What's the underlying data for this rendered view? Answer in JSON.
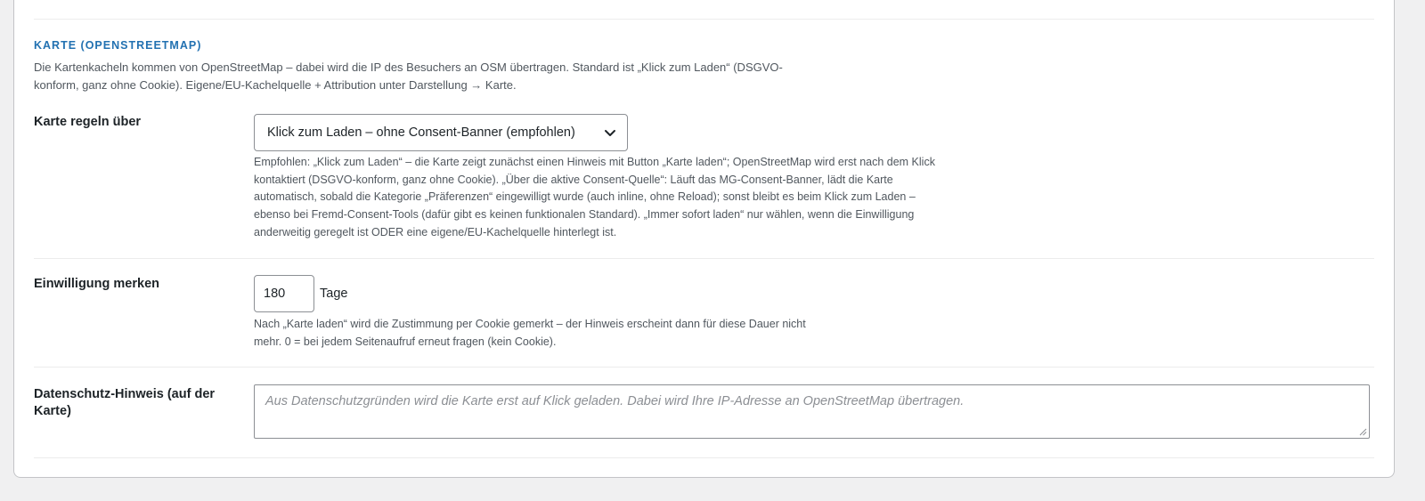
{
  "section": {
    "title": "KARTE (OPENSTREETMAP)",
    "description_line1": "Die Kartenkacheln kommen von OpenStreetMap – dabei wird die IP des Besuchers an OSM übertragen. Standard ist „Klick zum Laden“ (DSGVO-",
    "description_line2": "konform, ganz ohne Cookie). Eigene/EU-Kachelquelle + Attribution unter Darstellung → Karte."
  },
  "map_control": {
    "label": "Karte regeln über",
    "selected_value": "Klick zum Laden – ohne Consent-Banner (empfohlen)",
    "help_lines": [
      "Empfohlen: „Klick zum Laden“ – die Karte zeigt zunächst einen Hinweis mit Button „Karte laden“; OpenStreetMap wird erst nach dem Klick",
      "kontaktiert (DSGVO-konform, ganz ohne Cookie). „Über die aktive Consent-Quelle“: Läuft das MG-Consent-Banner, lädt die Karte",
      "automatisch, sobald die Kategorie „Präferenzen“ eingewilligt wurde (auch inline, ohne Reload); sonst bleibt es beim Klick zum Laden –",
      "ebenso bei Fremd-Consent-Tools (dafür gibt es keinen funktionalen Standard). „Immer sofort laden“ nur wählen, wenn die Einwilligung",
      "anderweitig geregelt ist ODER eine eigene/EU-Kachelquelle hinterlegt ist."
    ]
  },
  "consent_duration": {
    "label": "Einwilligung merken",
    "value": "180",
    "unit": "Tage",
    "help_lines": [
      "Nach „Karte laden“ wird die Zustimmung per Cookie gemerkt – der Hinweis erscheint dann für diese Dauer nicht",
      "mehr. 0 = bei jedem Seitenaufruf erneut fragen (kein Cookie)."
    ]
  },
  "privacy_notice": {
    "label_line1": "Datenschutz-Hinweis (auf der",
    "label_line2": "Karte)",
    "placeholder": "Aus Datenschutzgründen wird die Karte erst auf Klick geladen. Dabei wird Ihre IP-Adresse an OpenStreetMap übertragen."
  },
  "icons": {
    "select_arrow": "chevron-down-icon",
    "textarea_resize": "resize-grip-icon"
  },
  "colors": {
    "accent": "#2271b1",
    "text": "#1d2327",
    "muted": "#50575e",
    "placeholder": "#8c8f94",
    "background": "#f0f0f1"
  }
}
